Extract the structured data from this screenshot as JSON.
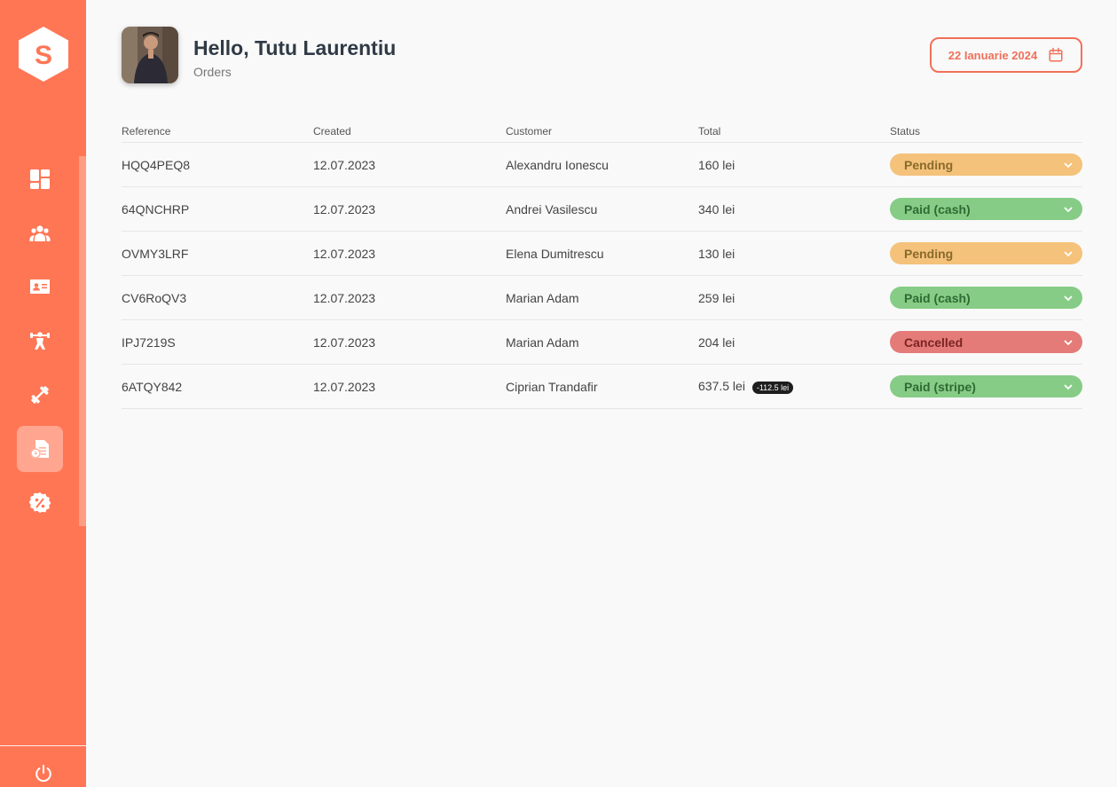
{
  "sidebar": {
    "logo_letter": "S",
    "items": [
      {
        "icon": "dashboard-icon"
      },
      {
        "icon": "users-icon"
      },
      {
        "icon": "id-card-icon"
      },
      {
        "icon": "trainer-icon"
      },
      {
        "icon": "dumbbell-icon"
      },
      {
        "icon": "orders-icon",
        "active": true
      },
      {
        "icon": "discount-icon"
      }
    ],
    "footer_icon": "power-icon"
  },
  "header": {
    "greeting": "Hello, Tutu Laurentiu",
    "subtitle": "Orders",
    "date": "22 Ianuarie 2024"
  },
  "table": {
    "columns": [
      "Reference",
      "Created",
      "Customer",
      "Total",
      "Status"
    ],
    "rows": [
      {
        "reference": "HQQ4PEQ8",
        "created": "12.07.2023",
        "customer": "Alexandru Ionescu",
        "total": "160 lei",
        "status": "Pending"
      },
      {
        "reference": "64QNCHRP",
        "created": "12.07.2023",
        "customer": "Andrei Vasilescu",
        "total": "340 lei",
        "status": "Paid (cash)"
      },
      {
        "reference": "OVMY3LRF",
        "created": "12.07.2023",
        "customer": "Elena Dumitrescu",
        "total": "130 lei",
        "status": "Pending"
      },
      {
        "reference": "CV6RoQV3",
        "created": "12.07.2023",
        "customer": "Marian Adam",
        "total": "259 lei",
        "status": "Paid (cash)"
      },
      {
        "reference": "IPJ7219S",
        "created": "12.07.2023",
        "customer": "Marian Adam",
        "total": "204 lei",
        "status": "Cancelled"
      },
      {
        "reference": "6ATQY842",
        "created": "12.07.2023",
        "customer": "Ciprian Trandafir",
        "total": "637.5 lei",
        "discount": "-112.5 lei",
        "status": "Paid (stripe)"
      }
    ]
  },
  "colors": {
    "accent": "#ff7655",
    "status_pending_bg": "#f4c27a",
    "status_pending_text": "#8a6a2c",
    "status_paid_bg": "#86cc86",
    "status_paid_text": "#2f6a33",
    "status_cancelled_bg": "#e47b79",
    "status_cancelled_text": "#7a2523"
  }
}
